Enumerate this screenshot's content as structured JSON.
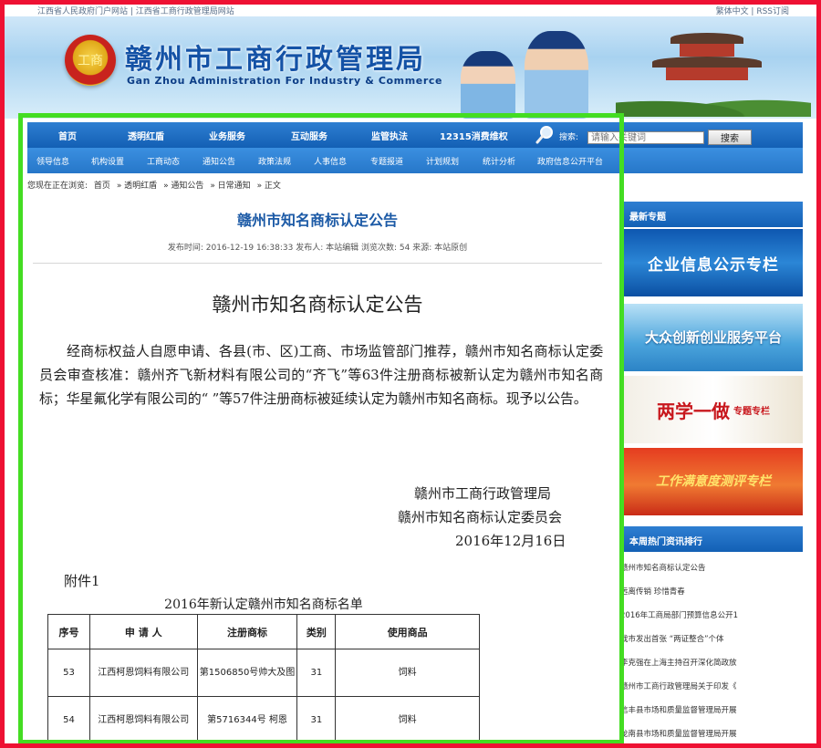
{
  "topbar": {
    "left": "江西省人民政府门户网站 | 江西省工商行政管理局网站",
    "right": "繁体中文 | RSS订阅"
  },
  "header": {
    "emblem_text": "工商",
    "title": "赣州市工商行政管理局",
    "subtitle": "Gan Zhou Administration For Industry & Commerce"
  },
  "nav_primary": [
    "首页",
    "透明红盾",
    "业务服务",
    "互动服务",
    "监管执法",
    "12315消费维权"
  ],
  "search": {
    "label": "搜索:",
    "placeholder": "请输入关键词",
    "button": "搜索"
  },
  "nav_secondary": [
    "领导信息",
    "机构设置",
    "工商动态",
    "通知公告",
    "政策法规",
    "人事信息",
    "专题报道",
    "计划规划",
    "统计分析",
    "政府信息公开平台"
  ],
  "breadcrumb": {
    "prefix": "您现在正在浏览:",
    "items": [
      "首页",
      "» 透明红盾",
      "» 通知公告",
      "» 日常通知",
      "» 正文"
    ]
  },
  "article": {
    "title": "赣州市知名商标认定公告",
    "meta": "发布时间: 2016-12-19 16:38:33  发布人: 本站编辑  浏览次数: 54  来源: 本站原创",
    "doc_title": "赣州市知名商标认定公告",
    "body": "经商标权益人自愿申请、各县(市、区)工商、市场监管部门推荐，赣州市知名商标认定委员会审查核准：赣州齐飞新材料有限公司的“齐飞”等63件注册商标被新认定为赣州市知名商标；华星氟化学有限公司的“ ”等57件注册商标被延续认定为赣州市知名商标。现予以公告。",
    "sign_1": "赣州市工商行政管理局",
    "sign_2": "赣州市知名商标认定委员会",
    "date": "2016年12月16日",
    "annex": "附件1",
    "list_title": "2016年新认定赣州市知名商标名单"
  },
  "table": {
    "headers": [
      "序号",
      "申 请 人",
      "注册商标",
      "类别",
      "使用商品"
    ],
    "rows": [
      [
        "53",
        "江西柯恩饲料有限公司",
        "第1506850号帅大及图",
        "31",
        "饲料"
      ],
      [
        "54",
        "江西柯恩饲料有限公司",
        "第5716344号 柯恩",
        "31",
        "饲料"
      ]
    ]
  },
  "sidebar": {
    "latest_topics": "最新专题",
    "banners": [
      "企业信息公示专栏",
      "大众创新创业服务平台",
      "两学一做",
      "专题专栏",
      "工作满意度测评专栏"
    ],
    "hot_title": "本周热门资讯排行",
    "hot_items": [
      "赣州市知名商标认定公告",
      "远离传销 珍惜青春",
      "2016年工商局部门预算信息公开1",
      "我市发出首张 “两证整合”个体",
      "李克强在上海主持召开深化简政放",
      "赣州市工商行政管理局关于印发《",
      "信丰县市场和质量监督管理局开展",
      "龙南县市场和质量监督管理局开展"
    ]
  }
}
